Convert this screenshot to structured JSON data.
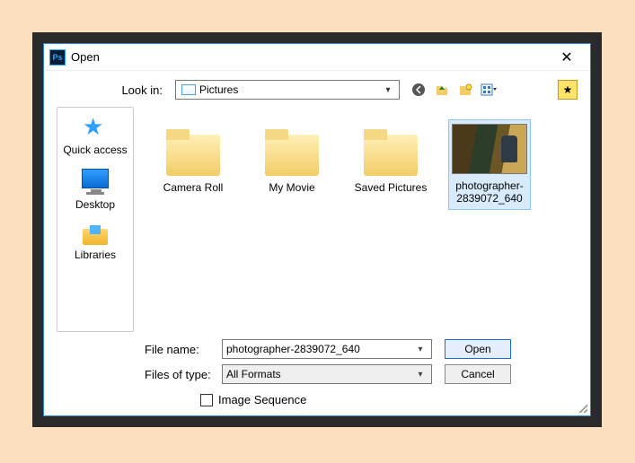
{
  "dialog": {
    "title": "Open",
    "lookin_label": "Look in:",
    "lookin_value": "Pictures",
    "nav_icons": [
      "back",
      "up",
      "new-folder",
      "view-menu"
    ],
    "special_tool": "star"
  },
  "places": [
    {
      "label": "Quick access",
      "icon": "star"
    },
    {
      "label": "Desktop",
      "icon": "desktop"
    },
    {
      "label": "Libraries",
      "icon": "libraries"
    }
  ],
  "files": [
    {
      "label": "Camera Roll",
      "kind": "folder",
      "selected": false
    },
    {
      "label": "My Movie",
      "kind": "folder",
      "selected": false
    },
    {
      "label": "Saved Pictures",
      "kind": "folder",
      "selected": false
    },
    {
      "label": "photographer-2839072_640",
      "kind": "image",
      "selected": true
    }
  ],
  "form": {
    "filename_label": "File name:",
    "filename_value": "photographer-2839072_640",
    "filetype_label": "Files of type:",
    "filetype_value": "All Formats",
    "open_label": "Open",
    "cancel_label": "Cancel",
    "checkbox_label": "Image Sequence",
    "checkbox_checked": false
  }
}
